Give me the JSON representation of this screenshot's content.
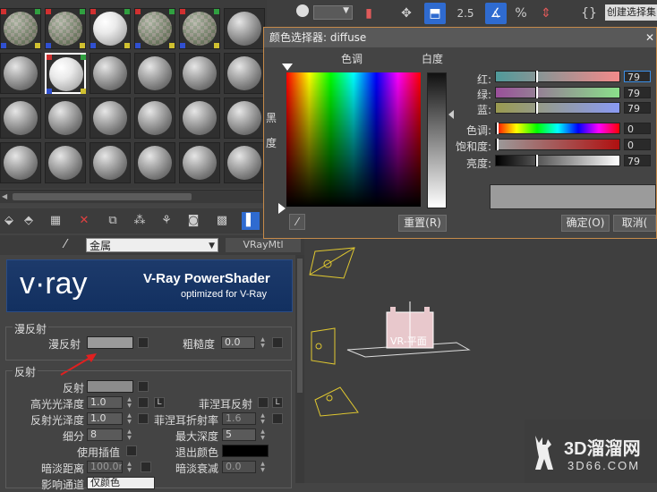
{
  "dialog": {
    "title": "颜色选择器: diffuse",
    "hue_label": "色调",
    "whiteness_label": "白度",
    "blackness_label_1": "黑",
    "blackness_label_2": "度",
    "reset_button": "重置(R)",
    "ok_button": "确定(O)",
    "cancel_button": "取消(",
    "channels": [
      {
        "label": "红:",
        "value": "79"
      },
      {
        "label": "绿:",
        "value": "79"
      },
      {
        "label": "蓝:",
        "value": "79"
      },
      {
        "label": "色调:",
        "value": "0"
      },
      {
        "label": "饱和度:",
        "value": "0"
      },
      {
        "label": "亮度:",
        "value": "79"
      }
    ],
    "selected_color": "#9b9b9b",
    "accent_border": "#c58a4a"
  },
  "toolbar": {
    "count_label": "2.5",
    "create_selection": "创建选择集"
  },
  "material_row": {
    "material_name": "金属",
    "material_type": "VRayMtl"
  },
  "vray": {
    "logo_text": "v·ray",
    "title": "V-Ray PowerShader",
    "subtitle": "optimized for V-Ray"
  },
  "diffuse_group": {
    "header": "漫反射",
    "diffuse_label": "漫反射",
    "roughness_label": "粗糙度",
    "roughness_value": "0.0"
  },
  "reflection_group": {
    "header": "反射",
    "reflect_label": "反射",
    "hilight_gloss_label": "高光光泽度",
    "hilight_gloss_value": "1.0",
    "refl_gloss_label": "反射光泽度",
    "refl_gloss_value": "1.0",
    "subdivs_label": "细分",
    "subdivs_value": "8",
    "use_interp_label": "使用插值",
    "dim_distance_label": "暗淡距离",
    "dim_distance_value": "100.0r",
    "affect_channels_label": "影响通道",
    "affect_channels_value": "仅颜色",
    "fresnel_label": "菲涅耳反射",
    "fresnel_lock_label": "L",
    "fresnel_ior_label": "菲涅耳折射率",
    "fresnel_ior_value": "1.6",
    "max_depth_label": "最大深度",
    "max_depth_value": "5",
    "exit_color_label": "退出颜色",
    "dim_falloff_label": "暗淡衰减",
    "dim_falloff_value": "0.0",
    "lock_label": "L"
  },
  "viewport": {
    "object_label": "VR-平面"
  },
  "watermark": {
    "brand": "3D溜溜网",
    "url": "3D66.COM"
  }
}
